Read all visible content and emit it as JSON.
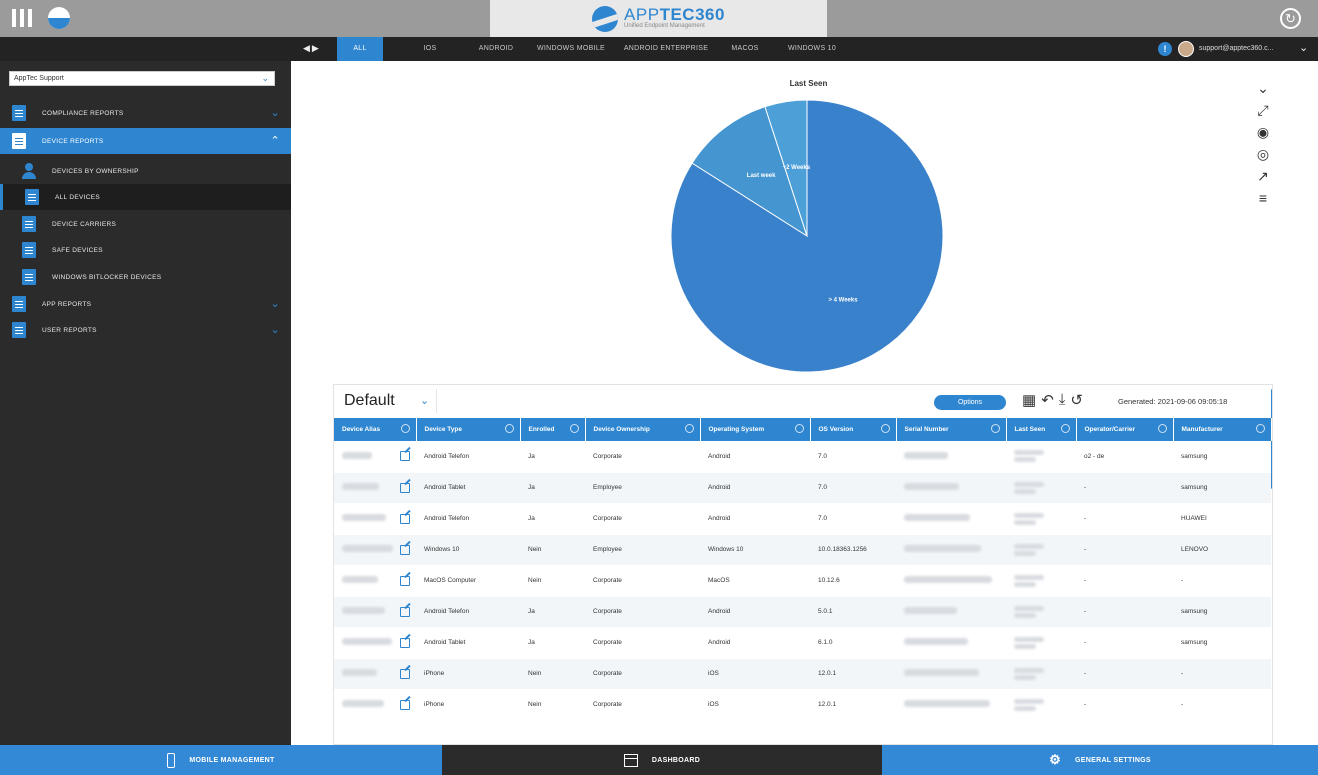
{
  "app": {
    "brand_name_light": "APP",
    "brand_name_bold": "TEC360",
    "brand_tagline": "Unified Endpoint Management"
  },
  "platform_tabs": [
    {
      "label": "ALL",
      "active": true
    },
    {
      "label": "iOS",
      "active": false
    },
    {
      "label": "ANDROID",
      "active": false
    },
    {
      "label": "WINDOWS MOBILE",
      "active": false
    },
    {
      "label": "ANDROID ENTERPRISE",
      "active": false
    },
    {
      "label": "MACOS",
      "active": false
    },
    {
      "label": "WINDOWS 10",
      "active": false
    }
  ],
  "user": {
    "email": "support@apptec360.c..."
  },
  "sidebar": {
    "org_select": "AppTec Support",
    "items": [
      {
        "label": "COMPLIANCE REPORTS",
        "kind": "section",
        "expanded": false
      },
      {
        "label": "DEVICE REPORTS",
        "kind": "section",
        "expanded": true
      },
      {
        "label": "DEVICES BY OWNERSHIP",
        "kind": "child"
      },
      {
        "label": "ALL DEVICES",
        "kind": "child",
        "selected": true
      },
      {
        "label": "DEVICE CARRIERS",
        "kind": "child"
      },
      {
        "label": "SAFE DEVICES",
        "kind": "child"
      },
      {
        "label": "WINDOWS BITLOCKER DEVICES",
        "kind": "child"
      },
      {
        "label": "APP REPORTS",
        "kind": "section",
        "expanded": false
      },
      {
        "label": "USER REPORTS",
        "kind": "section",
        "expanded": false
      }
    ]
  },
  "chart_data": {
    "type": "pie",
    "title": "Last Seen",
    "categories": [
      "> 4 Weeks",
      "Last week",
      "~2 Weeks"
    ],
    "values": [
      84,
      11,
      5
    ],
    "colors": [
      "#3a81cc",
      "#4595d1",
      "#4d9fd8"
    ]
  },
  "chart_tools": [
    "chevron-down-icon",
    "fullscreen-icon",
    "pie-chart-icon",
    "donut-chart-icon",
    "bar-chart-icon",
    "sort-list-icon"
  ],
  "report": {
    "view_name": "Default",
    "options_label": "Options",
    "generated_label": "Generated: 2021-09-06 09:05:18",
    "columns": [
      "Device Alias",
      "Device Type",
      "Enrolled",
      "Device Ownership",
      "Operating System",
      "OS Version",
      "Serial Number",
      "Last Seen",
      "Operator/Carrier",
      "Manufacturer"
    ],
    "rows": [
      {
        "type": "Android Telefon",
        "enrolled": "Ja",
        "ownership": "Corporate",
        "os": "Android",
        "os_version": "7.0",
        "operator": "o2 - de",
        "manufacturer": "samsung"
      },
      {
        "type": "Android Tablet",
        "enrolled": "Ja",
        "ownership": "Employee",
        "os": "Android",
        "os_version": "7.0",
        "operator": "-",
        "manufacturer": "samsung"
      },
      {
        "type": "Android Telefon",
        "enrolled": "Ja",
        "ownership": "Corporate",
        "os": "Android",
        "os_version": "7.0",
        "operator": "-",
        "manufacturer": "HUAWEI"
      },
      {
        "type": "Windows 10",
        "enrolled": "Nein",
        "ownership": "Employee",
        "os": "Windows 10",
        "os_version": "10.0.18363.1256",
        "operator": "-",
        "manufacturer": "LENOVO"
      },
      {
        "type": "MacOS Computer",
        "enrolled": "Nein",
        "ownership": "Corporate",
        "os": "MacOS",
        "os_version": "10.12.6",
        "operator": "-",
        "manufacturer": "-"
      },
      {
        "type": "Android Telefon",
        "enrolled": "Ja",
        "ownership": "Corporate",
        "os": "Android",
        "os_version": "5.0.1",
        "operator": "-",
        "manufacturer": "samsung"
      },
      {
        "type": "Android Tablet",
        "enrolled": "Ja",
        "ownership": "Corporate",
        "os": "Android",
        "os_version": "6.1.0",
        "operator": "-",
        "manufacturer": "samsung"
      },
      {
        "type": "iPhone",
        "enrolled": "Nein",
        "ownership": "Corporate",
        "os": "iOS",
        "os_version": "12.0.1",
        "operator": "-",
        "manufacturer": "-"
      },
      {
        "type": "iPhone",
        "enrolled": "Nein",
        "ownership": "Corporate",
        "os": "iOS",
        "os_version": "12.0.1",
        "operator": "-",
        "manufacturer": "-"
      }
    ]
  },
  "bottom_nav": [
    {
      "label": "MOBILE MANAGEMENT",
      "icon": "phone-icon",
      "active": true
    },
    {
      "label": "DASHBOARD",
      "icon": "dashboard-icon",
      "active": false
    },
    {
      "label": "GENERAL SETTINGS",
      "icon": "gear-icon",
      "active": true
    }
  ],
  "colors": {
    "accent": "#2f86d0",
    "topbar": "#9b9b9b",
    "tabbar": "#232323",
    "sidebar": "#2b2b2b",
    "dashboard_bar": "#2b2b2b"
  }
}
